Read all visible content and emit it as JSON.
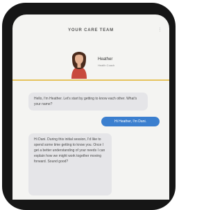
{
  "header": {
    "title": "YOUR CARE TEAM",
    "menu_icon": "more-vertical-icon"
  },
  "profile": {
    "name": "Heather",
    "role": "Health Coach",
    "avatar_icon": "avatar-photo"
  },
  "colors": {
    "divider": "#e6c35c",
    "outgoing_bubble": "#3b7fcf",
    "incoming_bubble": "#e5e5e8"
  },
  "messages": [
    {
      "from": "coach",
      "text": "Hello, I'm Heather. Let's start by getting to know each other. What's your name?"
    },
    {
      "from": "user",
      "text": "Hi Heather, I'm Dani."
    },
    {
      "from": "coach",
      "text": "Hi Dani. During this initial session, I'd like to spend some time getting to know you. Once I get a better understanding of your needs I can explain how we might work together moving forward. Sound good?"
    }
  ]
}
